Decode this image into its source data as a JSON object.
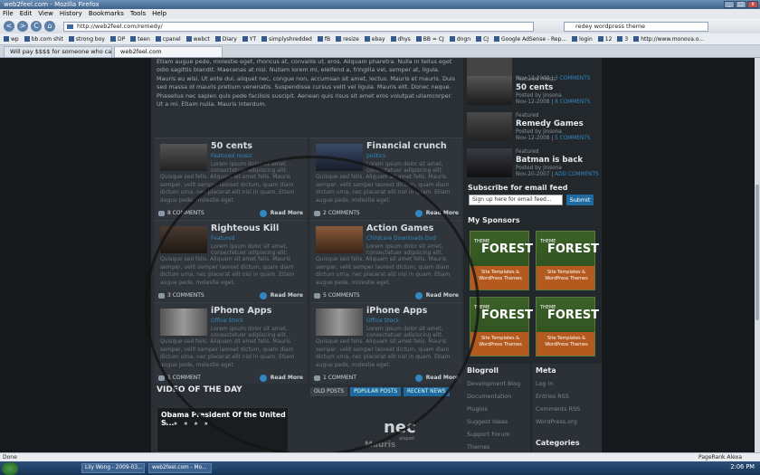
{
  "window": {
    "title": "web2feel.com - Mozilla Firefox",
    "buttons": [
      "_",
      "□",
      "x"
    ]
  },
  "menu": [
    "File",
    "Edit",
    "View",
    "History",
    "Bookmarks",
    "Tools",
    "Help"
  ],
  "nav": {
    "back": "<",
    "forward": ">",
    "reload": "C",
    "home": "⌂",
    "url": "http://web2feel.com/remedy/",
    "search": "redey wordpress theme"
  },
  "bookmarks": [
    "wp",
    "bb.com shit",
    "strong boy",
    "DP",
    "teen",
    "cpanel",
    "webct",
    "Diary",
    "YT",
    "simplyshredded",
    "fB",
    "resize",
    "ebay",
    "dhys",
    "BB = CJ",
    "dngn",
    "CJ",
    "Google AdSense - Rep...",
    "login",
    "12",
    "3",
    "http://www.monova.o..."
  ],
  "tabs": [
    "Will pay $$$$ for someone who can...",
    "web2feel.com"
  ],
  "intro": "Etiam augue pede, molestie eget, rhoncus at, convallis ut, eros. Aliquam pharetra. Nulla in tellus eget odio sagittis blandit. Maecenas at nisl. Nullam lorem mi, eleifend a, fringilla vel, semper at, ligula. Mauris eu wisi. Ut ante dui, aliquet nec, congue non, accumsan sit amet, lectus. Mauris et mauris. Duis sed massa id mauris pretium venenatis. Suspendisse cursus velit vel ligula. Mauris elit. Donec neque. Phasellus nec sapien quis pede facilisis suscipit. Aenean quis risus sit amet eros volutpat ullamcorper. Ut a mi. Etiam nulla. Mauris interdum.",
  "posts": [
    {
      "title": "50 cents",
      "category": "Featured music",
      "comments": "8 COMMENTS",
      "more": "Read More"
    },
    {
      "title": "Financial crunch",
      "category": "politics",
      "comments": "2 COMMENTS",
      "more": "Read More"
    },
    {
      "title": "Righteous Kill",
      "category": "Featured",
      "comments": "3 COMMENTS",
      "more": "Read More"
    },
    {
      "title": "Action Games",
      "category": "Childcare Downloads Dvd",
      "comments": "5 COMMENTS",
      "more": "Read More"
    },
    {
      "title": "iPhone Apps",
      "category": "Office Stock",
      "comments": "1 COMMENT",
      "more": "Read More"
    },
    {
      "title": "iPhone Apps",
      "category": "Office Stock",
      "comments": "1 COMMENT",
      "more": "Read More"
    }
  ],
  "post_body": "Lorem ipsum dolor sit amet, consectetuer adipiscing elit.",
  "post_body2": "Quisque sed felis. Aliquam sit amet felis. Mauris semper, velit semper laoreet dictum, quam diam dictum urna, nec placerat elit nisl in quam. Etiam augue pede, molestie eget.",
  "video": {
    "heading": "VIDEO OF THE DAY",
    "title": "Obama President Of the United S...",
    "stars": "★ ★ ★ ★ ★"
  },
  "news_tabs": [
    "OLD POSTS",
    "POPULAR POSTS",
    "RECENT NEWS"
  ],
  "ad_center": {
    "brand": "nec",
    "sub": "Mauris",
    "small": "aliquet"
  },
  "side_posts": [
    {
      "category": "",
      "title": "",
      "by": "",
      "date": "Nov-12-2008",
      "comments": "3 COMMENTS"
    },
    {
      "category": "Featured music",
      "title": "50 cents",
      "by": "Posted by jinsona",
      "date": "Nov-12-2008",
      "comments": "8 COMMENTS"
    },
    {
      "category": "Featured",
      "title": "Remedy Games",
      "by": "Posted by jinsona",
      "date": "Nov-12-2008",
      "comments": "5 COMMENTS"
    },
    {
      "category": "Featured",
      "title": "Batman is back",
      "by": "Posted by jinsona",
      "date": "Nov-20-2007",
      "comments": "ADD COMMENTS"
    }
  ],
  "subscribe": {
    "heading": "Subscribe for email feed",
    "placeholder": "Sign up here for email feed...",
    "button": "Submit"
  },
  "sponsors": {
    "heading": "My Sponsors",
    "ads": [
      {
        "lead": "THEME",
        "logo": "FOREST",
        "line": "Site Templates & WordPress Themes"
      },
      {
        "lead": "THEME",
        "logo": "FOREST",
        "line": "Site Templates & WordPress Themes"
      },
      {
        "lead": "THEME",
        "logo": "FOREST",
        "line": "Site Templates & WordPress Themes"
      },
      {
        "lead": "THEME",
        "logo": "FOREST",
        "line": "Site Templates & WordPress Themes"
      }
    ]
  },
  "blogroll": {
    "heading": "Blogroll",
    "items": [
      "Development Blog",
      "Documentation",
      "Plugins",
      "Suggest Ideas",
      "Support Forum",
      "Themes"
    ]
  },
  "meta": {
    "heading": "Meta",
    "items": [
      "Log in",
      "Entries RSS",
      "Comments RSS",
      "WordPress.org"
    ]
  },
  "categories": {
    "heading": "Categories"
  },
  "status": {
    "left": "Done",
    "right": "PageRank  Alexa"
  },
  "taskbar": {
    "items": [
      "Lily Wong - 2009-03...",
      "web2feel.com - Mo..."
    ],
    "clock": "2:06 PM"
  }
}
